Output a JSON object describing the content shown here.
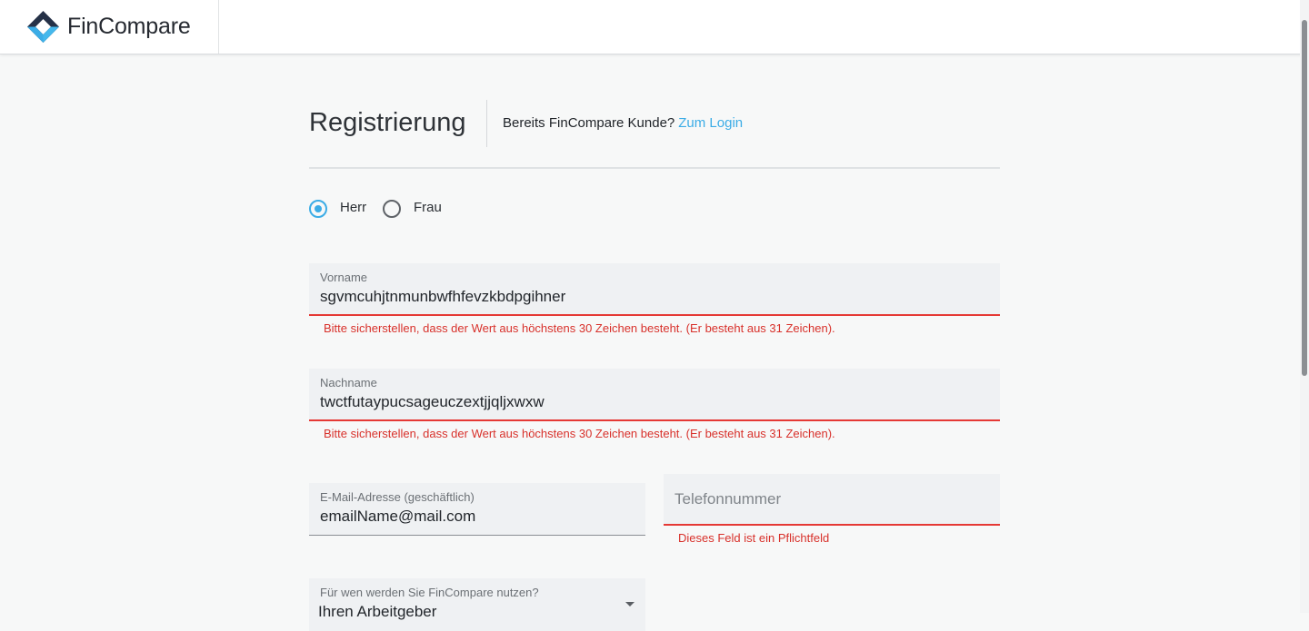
{
  "header": {
    "brand": "FinCompare",
    "logo_icon": "fincompare-logo-icon"
  },
  "page": {
    "title": "Registrierung",
    "login_prompt": "Bereits FinCompare Kunde?",
    "login_link": "Zum Login"
  },
  "salutation": {
    "options": [
      {
        "label": "Herr",
        "checked": true
      },
      {
        "label": "Frau",
        "checked": false
      }
    ]
  },
  "form": {
    "first_name": {
      "label": "Vorname",
      "value": "sgvmcuhjtnmunbwfhfevzkbdpgihner",
      "error": "Bitte sicherstellen, dass der Wert aus höchstens 30 Zeichen besteht. (Er besteht aus 31 Zeichen)."
    },
    "last_name": {
      "label": "Nachname",
      "value": "twctfutaypucsageuczextjjqljxwxw",
      "error": "Bitte sicherstellen, dass der Wert aus höchstens 30 Zeichen besteht. (Er besteht aus 31 Zeichen)."
    },
    "email": {
      "label": "E-Mail-Adresse (geschäftlich)",
      "value": "emailName@mail.com"
    },
    "phone": {
      "placeholder": "Telefonnummer",
      "error": "Dieses Feld ist ein Pflichtfeld"
    },
    "usage": {
      "label": "Für wen werden Sie FinCompare nutzen?",
      "value": "Ihren Arbeitgeber"
    }
  },
  "colors": {
    "accent": "#3bace6",
    "error": "#e53935",
    "field_bg": "#eff1f3",
    "page_bg": "#f7f8f8"
  }
}
